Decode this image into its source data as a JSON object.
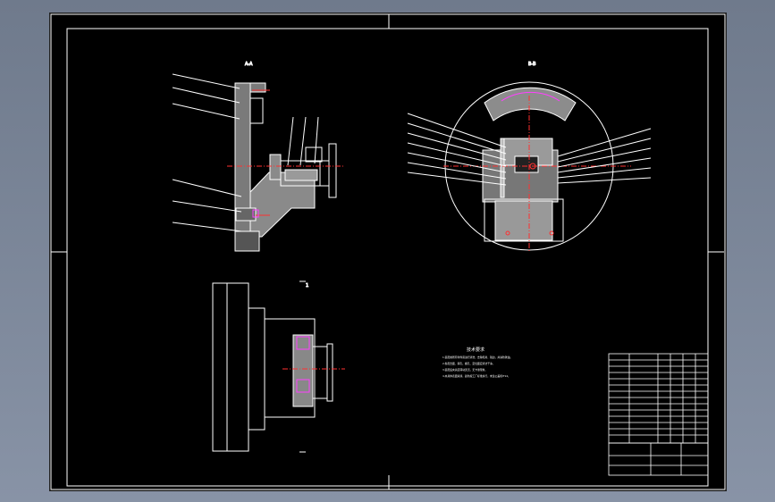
{
  "sheet": {
    "view_a_label": "A-A",
    "view_b_label": "B-B",
    "view_c_label": "1",
    "tech_title": "技术要求",
    "tech_lines": [
      "1.装配前所有零件需进行清洗，去除毛刺、锐边，并涂防锈油。",
      "2.各配合面、销孔、螺孔、定位面应清洁干净。",
      "3.装配后夹具应转动灵活，无卡滞现象。",
      "4.夹具体表面涂漆，颜色按工厂标准执行，未注公差按IT14。"
    ]
  },
  "colors": {
    "paper": "#000000",
    "line": "#ffffff",
    "center": "#ff3030",
    "accent": "#ff40ff",
    "frame": "#ffffff"
  }
}
